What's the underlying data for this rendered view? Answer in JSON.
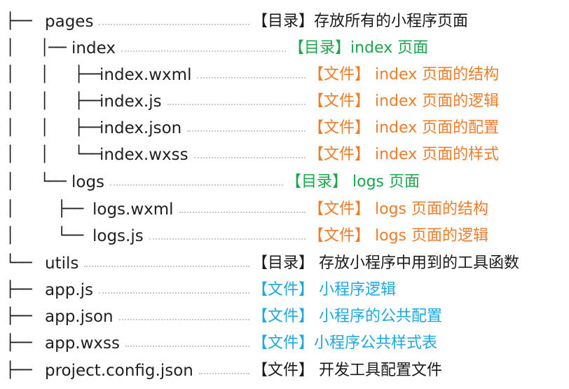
{
  "palette": {
    "black": "#1a1a1a",
    "green": "#1aa64a",
    "orange": "#ee7d2b",
    "blue": "#1ea7e0"
  },
  "tree": [
    {
      "id": "pages",
      "branch": "├── ",
      "name": "pages",
      "desc": "【目录】存放所有的小程序页面",
      "color": "black"
    },
    {
      "id": "index",
      "branch": "│   │── ",
      "name": "index",
      "desc": "【目录】index 页面",
      "color": "green"
    },
    {
      "id": "index-wxml",
      "branch": "│   │   ├── ",
      "name": "index.wxml",
      "desc": "【文件】 index 页面的结构",
      "color": "orange"
    },
    {
      "id": "index-js",
      "branch": "│   │   ├── ",
      "name": "index.js",
      "desc": "【文件】 index 页面的逻辑",
      "color": "orange"
    },
    {
      "id": "index-json",
      "branch": "│   │   ├── ",
      "name": "index.json",
      "desc": "【文件】 index 页面的配置",
      "color": "orange"
    },
    {
      "id": "index-wxss",
      "branch": "│   │   └── ",
      "name": "index.wxss",
      "desc": "【文件】 index 页面的样式",
      "color": "orange"
    },
    {
      "id": "logs",
      "branch": "│   └── ",
      "name": "logs",
      "desc": "【目录】 logs 页面",
      "color": "green"
    },
    {
      "id": "logs-wxml",
      "branch": "│     ├── ",
      "name": "logs.wxml",
      "desc": "【文件】 logs 页面的结构",
      "color": "orange"
    },
    {
      "id": "logs-js",
      "branch": "│     └── ",
      "name": "logs.js",
      "desc": "【文件】 logs 页面的逻辑",
      "color": "orange"
    },
    {
      "id": "utils",
      "branch": "└── ",
      "name": "utils",
      "desc": "【目录】 存放小程序中用到的工具函数",
      "color": "black"
    },
    {
      "id": "app-js",
      "branch": "├── ",
      "name": "app.js",
      "desc": "【文件】 小程序逻辑",
      "color": "blue"
    },
    {
      "id": "app-json",
      "branch": "├── ",
      "name": "app.json",
      "desc": "【文件】 小程序的公共配置",
      "color": "blue"
    },
    {
      "id": "app-wxss",
      "branch": "├── ",
      "name": "app.wxss",
      "desc": "【文件】小程序公共样式表",
      "color": "blue"
    },
    {
      "id": "project-config-json",
      "branch": "├── ",
      "name": "project.config.json",
      "desc": "【文件】 开发工具配置文件",
      "color": "black"
    }
  ]
}
